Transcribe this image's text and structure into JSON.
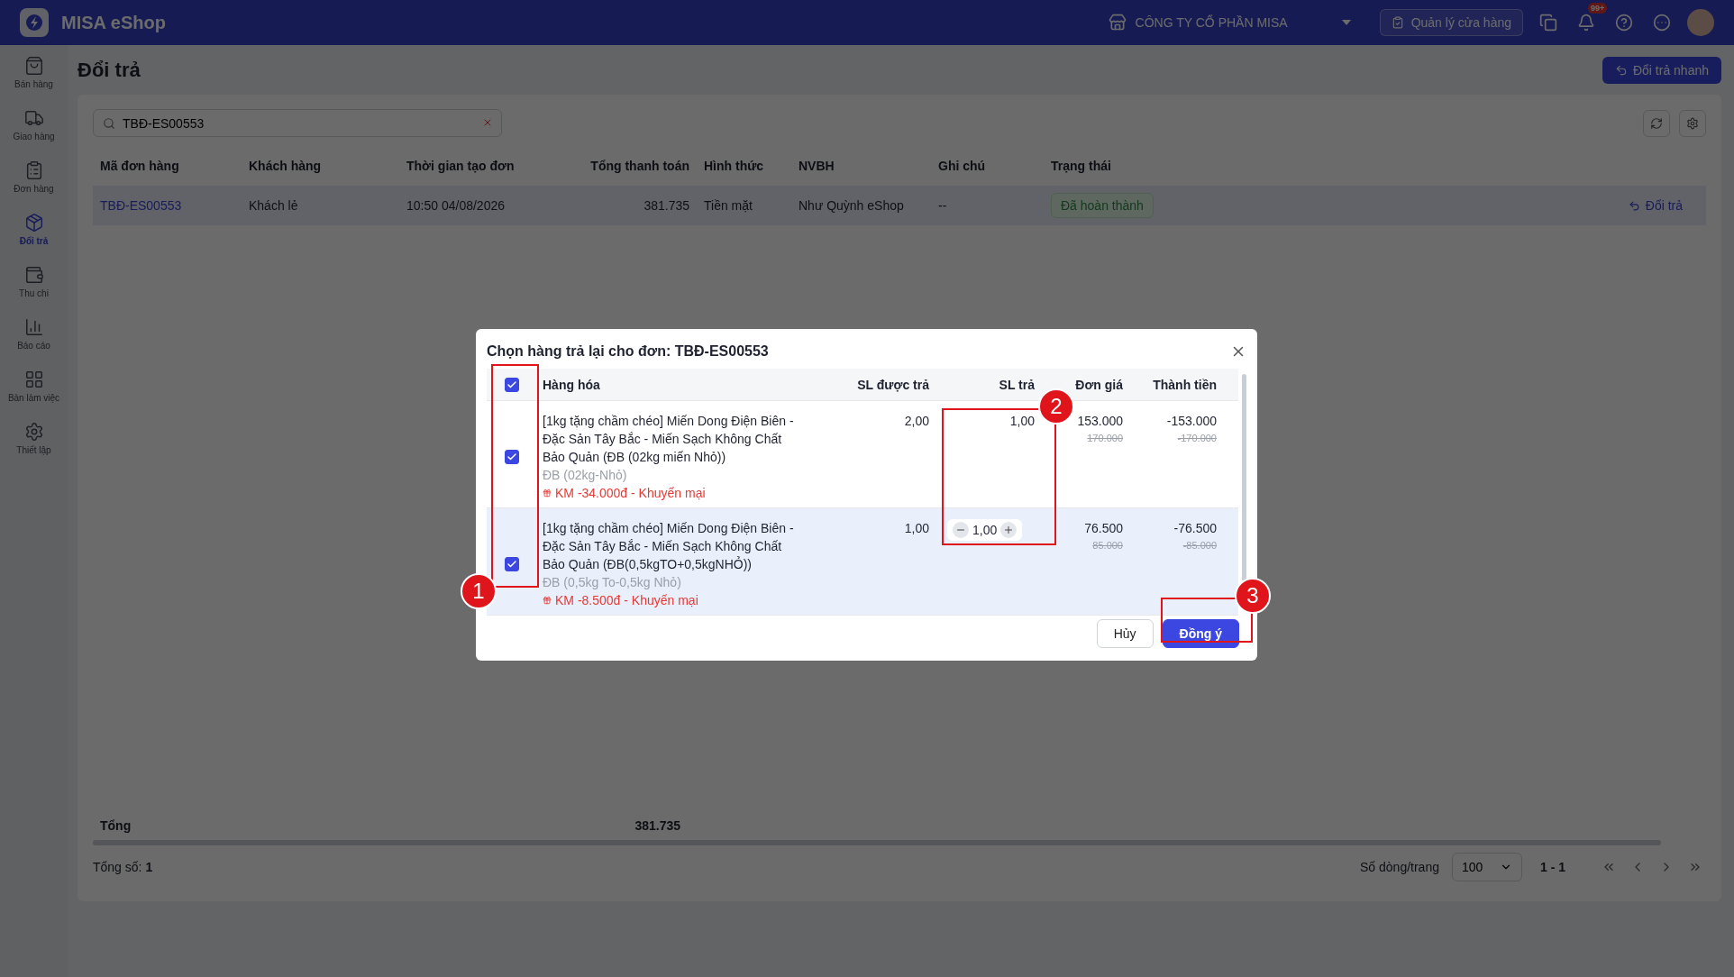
{
  "app": {
    "logo_text": "MISA eShop",
    "company": "CÔNG TY CỔ PHẦN MISA",
    "store_button": "Quản lý cửa hàng",
    "notification_badge": "99+"
  },
  "sidebar": {
    "items": [
      {
        "label": "Bán hàng",
        "selected": false
      },
      {
        "label": "Giao hàng",
        "selected": false
      },
      {
        "label": "Đơn hàng",
        "selected": false
      },
      {
        "label": "Đổi trả",
        "selected": true
      },
      {
        "label": "Thu chi",
        "selected": false
      },
      {
        "label": "Báo cáo",
        "selected": false
      },
      {
        "label": "Bàn làm việc",
        "selected": false
      },
      {
        "label": "Thiết lập",
        "selected": false
      }
    ]
  },
  "page": {
    "title": "Đổi trả",
    "quick_return_button": "Đổi trả nhanh"
  },
  "search": {
    "value": "TBĐ-ES00553"
  },
  "orders_table": {
    "columns": [
      "Mã đơn hàng",
      "Khách hàng",
      "Thời gian tạo đơn",
      "Tổng thanh toán",
      "Hình thức",
      "NVBH",
      "Ghi chú",
      "Trạng thái"
    ],
    "rows": [
      {
        "code": "TBĐ-ES00553",
        "customer": "Khách lẻ",
        "created": "10:50 04/08/2026",
        "total": "381.735",
        "payment": "Tiền mặt",
        "staff": "Như Quỳnh eShop",
        "note": "--",
        "status": "Đã hoàn thành",
        "action": "Đổi trả"
      }
    ]
  },
  "totals": {
    "label": "Tổng",
    "value": "381.735"
  },
  "pagination": {
    "total_label": "Tổng số:",
    "total": "1",
    "rows_per_page_label": "Số dòng/trang",
    "rows_per_page": "100",
    "range": "1 - 1"
  },
  "dialog": {
    "title": "Chọn hàng trả lại cho đơn: TBĐ-ES00553",
    "select_all_checked": true,
    "columns": [
      "Hàng hóa",
      "SL được trả",
      "SL trả",
      "Đơn giá",
      "Thành tiền"
    ],
    "items": [
      {
        "checked": true,
        "selected": false,
        "kind": "text",
        "name": "[1kg tặng chầm chéo] Miến Dong Điện Biên - Đặc Sản Tây Bắc - Miến Sạch Không Chất Bảo Quản (ĐB (02kg miến Nhỏ))",
        "variant": "ĐB (02kg-Nhỏ)",
        "promo": "KM -34.000đ - Khuyến mại",
        "returnable": "2,00",
        "return_qty": "1,00",
        "price": "153.000",
        "original_price": "170.000",
        "amount": "-153.000",
        "original_amount": "-170.000"
      },
      {
        "checked": true,
        "selected": true,
        "kind": "stepper",
        "name": "[1kg tặng chầm chéo] Miến Dong Điện Biên - Đặc Sản Tây Bắc - Miến Sạch Không Chất Bảo Quản (ĐB(0,5kgTO+0,5kgNHỎ))",
        "variant": "ĐB (0,5kg To-0,5kg Nhỏ)",
        "promo": "KM -8.500đ - Khuyến mại",
        "returnable": "1,00",
        "return_qty": "1,00",
        "price": "76.500",
        "original_price": "85.000",
        "amount": "-76.500",
        "original_amount": "-85.000"
      }
    ],
    "cancel_button": "Hủy",
    "confirm_button": "Đồng ý"
  },
  "annotations": [
    {
      "number": "1"
    },
    {
      "number": "2"
    },
    {
      "number": "3"
    }
  ]
}
